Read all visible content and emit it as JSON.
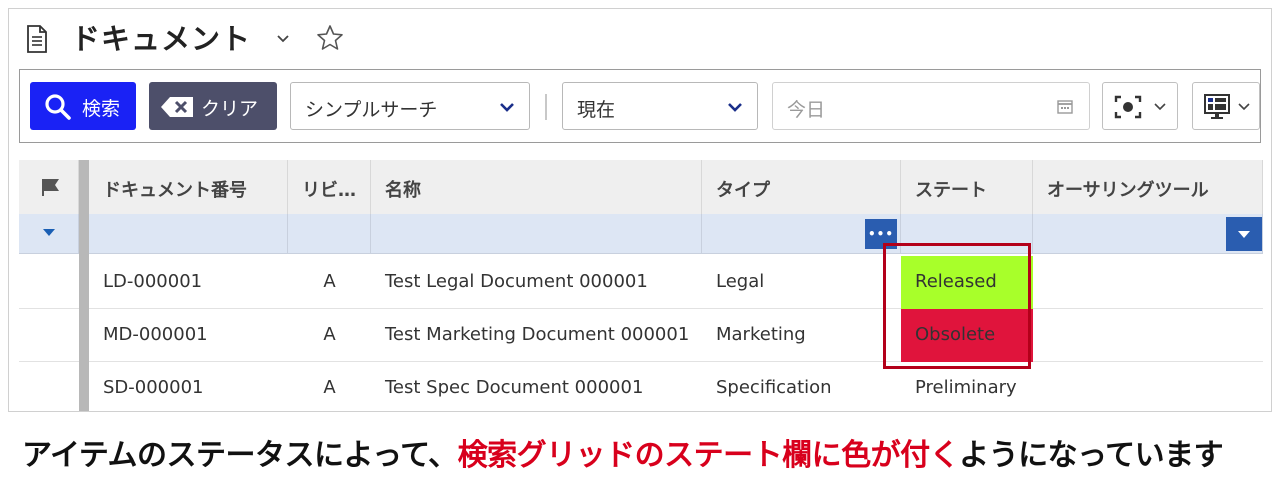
{
  "header": {
    "title": "ドキュメント"
  },
  "toolbar": {
    "search_label": "検索",
    "clear_label": "クリア",
    "search_mode": "シンプルサーチ",
    "revision_mode": "現在",
    "date_placeholder": "今日"
  },
  "grid": {
    "columns": [
      "ドキュメント番号",
      "リビ…",
      "名称",
      "タイプ",
      "ステート",
      "オーサリングツール"
    ],
    "filter_more": "•••",
    "rows": [
      {
        "number": "LD-000001",
        "rev": "A",
        "name": "Test Legal Document 000001",
        "type": "Legal",
        "state": "Released",
        "state_color": "#a8ff2a"
      },
      {
        "number": "MD-000001",
        "rev": "A",
        "name": "Test Marketing Document 000001",
        "type": "Marketing",
        "state": "Obsolete",
        "state_color": "#e0143c"
      },
      {
        "number": "SD-000001",
        "rev": "A",
        "name": "Test Spec Document 000001",
        "type": "Specification",
        "state": "Preliminary",
        "state_color": "#ffffff"
      }
    ]
  },
  "caption": {
    "part1": "アイテムのステータスによって、",
    "part2": "検索グリッドのステート欄に色が付く",
    "part3": "ようになっています"
  },
  "colors": {
    "accent_blue": "#1a22f5",
    "clear_button": "#4d4f6a",
    "highlight": "#b3001a",
    "caption_red": "#d8001c"
  }
}
